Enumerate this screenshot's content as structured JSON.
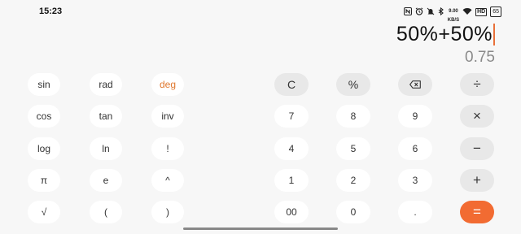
{
  "status_bar": {
    "time": "15:23",
    "icons": [
      "nfc-icon",
      "alarm-icon",
      "mute-icon",
      "bluetooth-icon",
      "network-speed-icon",
      "wifi-icon",
      "hd-icon",
      "battery-icon"
    ],
    "net_speed_value": "9.00",
    "net_speed_unit": "KB/S",
    "hd_label": "HD",
    "battery_level": "65"
  },
  "display": {
    "expression": "50%+50%",
    "result": "0.75"
  },
  "scientific_keys": [
    [
      "sin",
      "rad",
      "deg"
    ],
    [
      "cos",
      "tan",
      "inv"
    ],
    [
      "log",
      "ln",
      "!"
    ],
    [
      "π",
      "e",
      "^"
    ],
    [
      "√",
      "(",
      ")"
    ]
  ],
  "main_keys": [
    [
      "C",
      "%",
      "backspace",
      "÷"
    ],
    [
      "7",
      "8",
      "9",
      "×"
    ],
    [
      "4",
      "5",
      "6",
      "−"
    ],
    [
      "1",
      "2",
      "3",
      "+"
    ],
    [
      "00",
      "0",
      ".",
      "="
    ]
  ],
  "colors": {
    "accent": "#f26b32",
    "accent_text": "#e0782f",
    "background": "#f7f7f7",
    "key": "#ffffff",
    "key_dark": "#e8e8e8",
    "result_text": "#8a8a8a"
  }
}
